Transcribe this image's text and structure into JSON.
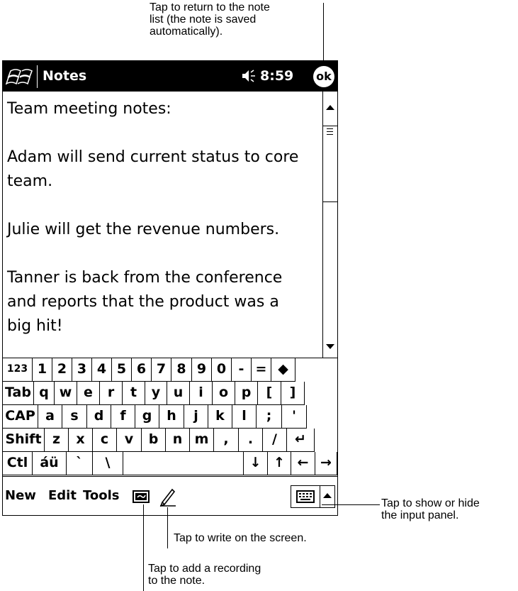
{
  "callouts": {
    "ok": "Tap to return to the note\nlist (the note is saved\nautomatically).",
    "input_panel": "Tap to show or hide\nthe input panel.",
    "write": "Tap to write on the screen.",
    "record": "Tap to add a recording\nto the note."
  },
  "titlebar": {
    "app_title": "Notes",
    "time": "8:59",
    "ok_label": "ok",
    "start_icon": "windows-flag-icon",
    "speaker_icon": "speaker-icon"
  },
  "note": {
    "lines": [
      "Team meeting notes:",
      "",
      "Adam will send current status to core",
      "team.",
      "",
      "Julie will get the revenue numbers.",
      "",
      "Tanner is back from the conference",
      "and reports that the product was a",
      "big hit!"
    ]
  },
  "keyboard": {
    "rows": [
      [
        "123",
        "1",
        "2",
        "3",
        "4",
        "5",
        "6",
        "7",
        "8",
        "9",
        "0",
        "-",
        "=",
        "◆"
      ],
      [
        "Tab",
        "q",
        "w",
        "e",
        "r",
        "t",
        "y",
        "u",
        "i",
        "o",
        "p",
        "[",
        "]"
      ],
      [
        "CAP",
        "a",
        "s",
        "d",
        "f",
        "g",
        "h",
        "j",
        "k",
        "l",
        ";",
        "'"
      ],
      [
        "Shift",
        "z",
        "x",
        "c",
        "v",
        "b",
        "n",
        "m",
        ",",
        ".",
        "/",
        "↵"
      ],
      [
        "Ctl",
        "áü",
        "`",
        "\\",
        "",
        "↓",
        "↑",
        "←",
        "→"
      ]
    ]
  },
  "menubar": {
    "items": [
      "New",
      "Edit",
      "Tools"
    ],
    "record_icon": "recording-icon",
    "pen_icon": "pen-icon",
    "input_panel_icon": "keyboard-icon",
    "input_arrow_icon": "up-arrow-icon"
  },
  "colors": {
    "titlebar_bg": "#000000",
    "background": "#ffffff",
    "text": "#000000"
  }
}
